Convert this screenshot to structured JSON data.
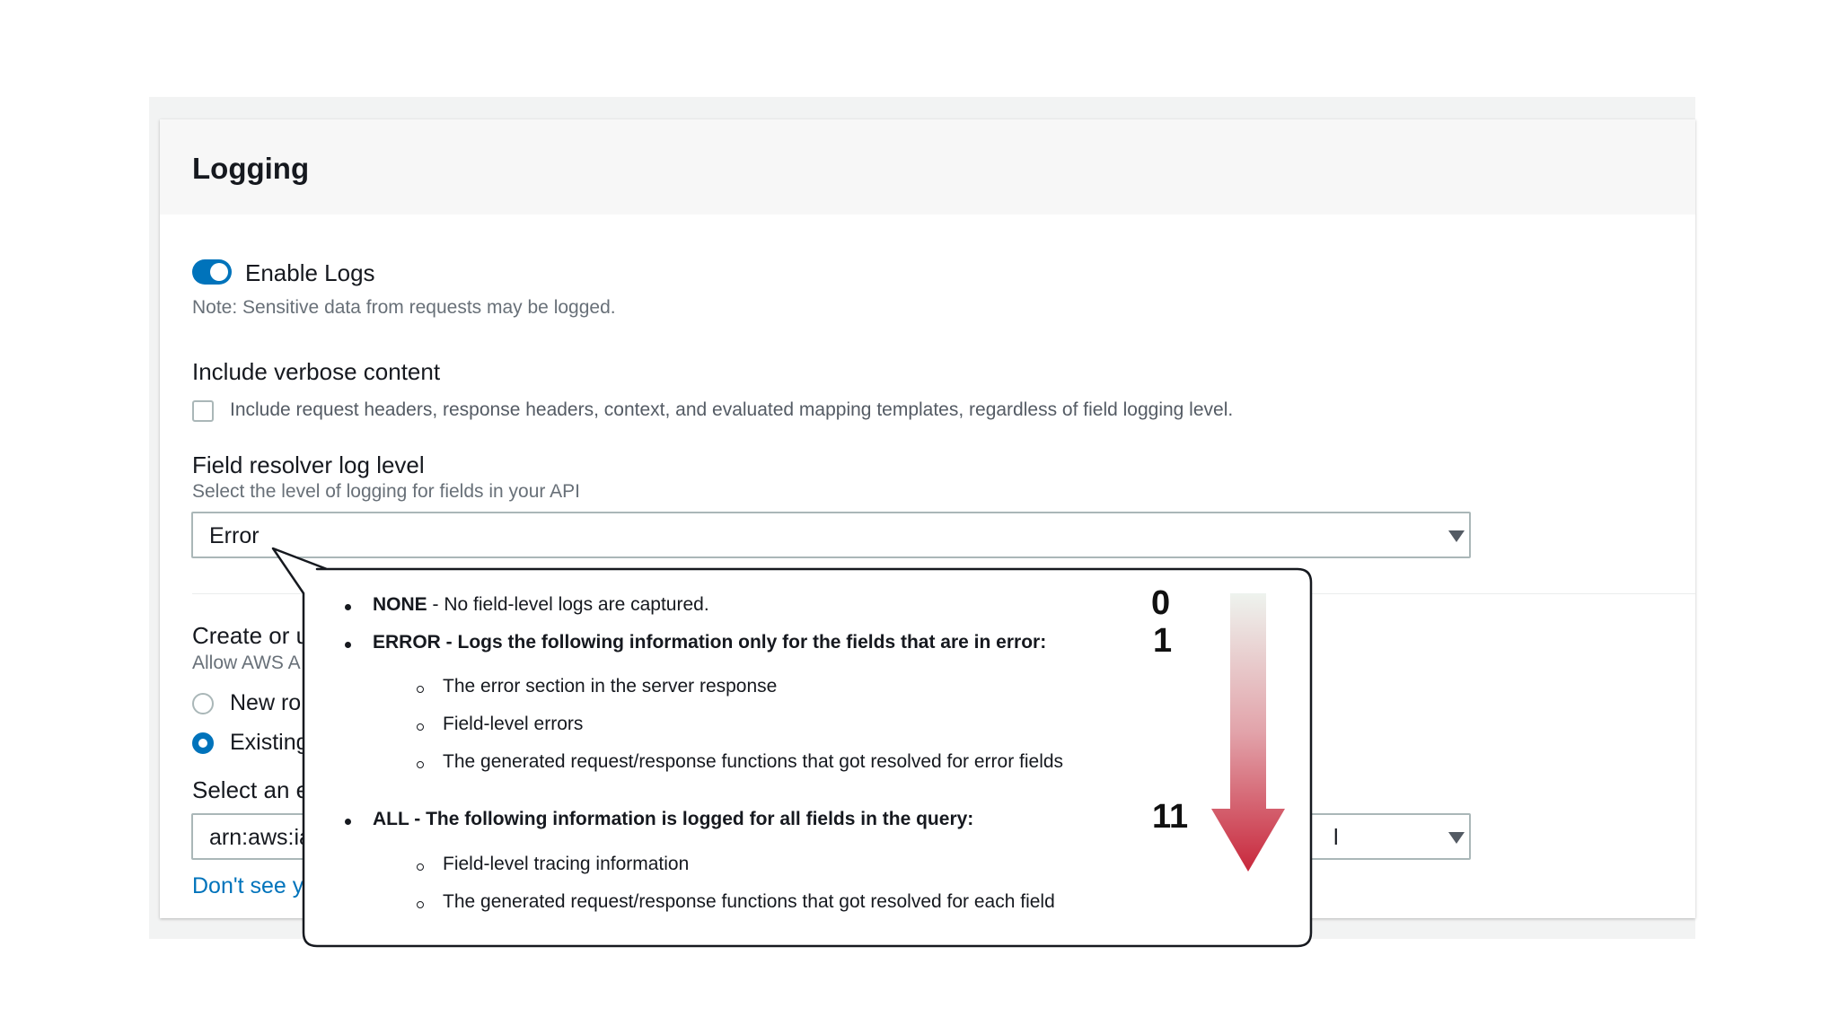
{
  "logging": {
    "title": "Logging",
    "enable_logs_label": "Enable Logs",
    "enable_logs_on": true,
    "note": "Note: Sensitive data from requests may be logged.",
    "verbose_label": "Include verbose content",
    "verbose_text": "Include request headers, response headers, context, and evaluated mapping templates, regardless of field logging level.",
    "verbose_checked": false,
    "resolver_label": "Field resolver log level",
    "resolver_desc": "Select the level of logging for fields in your API",
    "resolver_value": "Error"
  },
  "role": {
    "label": "Create or u",
    "desc": "Allow AWS A",
    "new_role": "New ro",
    "existing_role": "Existing",
    "select_existing": "Select an e",
    "arn_value": "arn:aws:ia",
    "arn_suffix": "l",
    "link": "Don't see y"
  },
  "callout": {
    "none": {
      "title": "NONE",
      "rest": " - No field-level logs are captured."
    },
    "error": {
      "title": "ERROR - Logs the following information only for the fields that are in error:",
      "items": [
        "The error section in the server response",
        "Field-level errors",
        "The generated request/response functions that got resolved for error fields"
      ]
    },
    "all": {
      "title": "ALL - The following information is logged for all fields in the query:",
      "items": [
        "Field-level tracing information",
        "The generated request/response functions that got resolved for each field"
      ]
    }
  },
  "scale": {
    "top": "0",
    "mid": "1",
    "bottom": "11"
  },
  "colors": {
    "accent": "#0073bb",
    "arrow_top": "#eef3ee",
    "arrow_bottom": "#c8283c"
  }
}
